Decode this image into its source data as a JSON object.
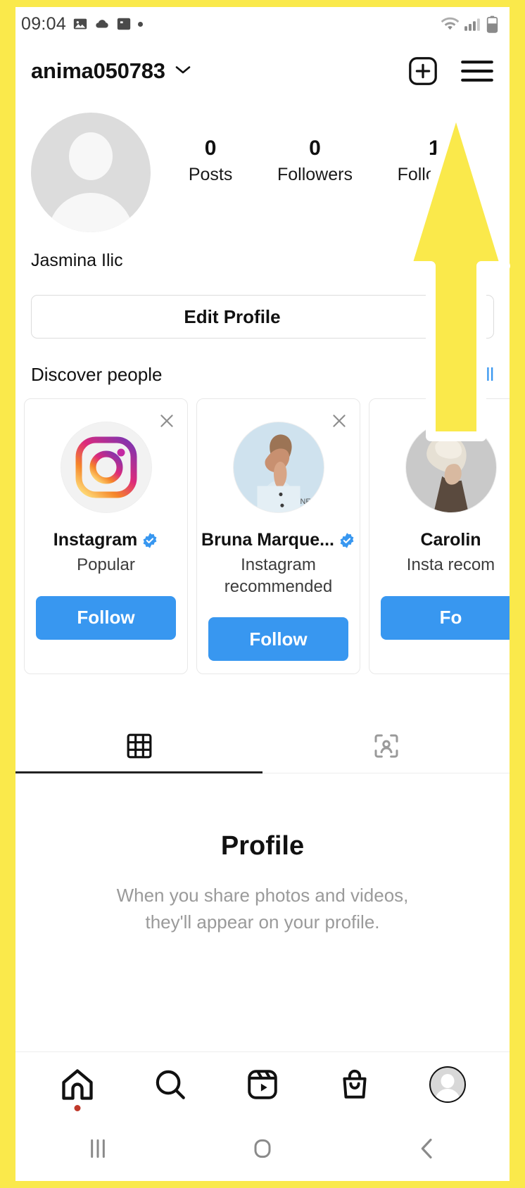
{
  "status_bar": {
    "time": "09:04",
    "icons": [
      "image-icon",
      "cloud-icon",
      "news-icon",
      "dot-icon"
    ],
    "right_icons": [
      "wifi-icon",
      "signal-icon",
      "battery-icon"
    ]
  },
  "header": {
    "username": "anima050783",
    "chevron": "chevron-down-icon",
    "add_button": "plus-square-icon",
    "menu_button": "hamburger-menu-icon"
  },
  "profile": {
    "avatar": "default-avatar-icon",
    "full_name": "Jasmina Ilic",
    "stats": [
      {
        "value": "0",
        "label": "Posts"
      },
      {
        "value": "0",
        "label": "Followers"
      },
      {
        "value": "1",
        "label": "Following"
      }
    ],
    "edit_button": "Edit Profile",
    "expand_button": "chevron-down-icon"
  },
  "discover": {
    "title": "Discover people",
    "see_all": "See All",
    "cards": [
      {
        "name": "Instagram",
        "subtitle": "Popular",
        "verified": true,
        "follow_label": "Follow",
        "avatar": "instagram-logo-icon",
        "close": "close-icon"
      },
      {
        "name": "Bruna Marque...",
        "subtitle": "Instagram recommended",
        "verified": true,
        "follow_label": "Follow",
        "avatar": "person-photo-icon",
        "close": "close-icon"
      },
      {
        "name": "Carolin",
        "subtitle": "Insta recom",
        "verified": false,
        "follow_label": "Fo",
        "avatar": "person-photo-icon",
        "close": "close-icon"
      }
    ]
  },
  "tabs": [
    {
      "name": "grid-tab",
      "icon": "grid-icon",
      "active": true
    },
    {
      "name": "tagged-tab",
      "icon": "tagged-person-icon",
      "active": false
    }
  ],
  "empty_state": {
    "title": "Profile",
    "line1": "When you share photos and videos,",
    "line2": "they'll appear on your profile."
  },
  "bottom_nav": [
    {
      "name": "home",
      "icon": "home-icon",
      "badge": true
    },
    {
      "name": "search",
      "icon": "search-icon",
      "badge": false
    },
    {
      "name": "reels",
      "icon": "reels-icon",
      "badge": false
    },
    {
      "name": "shop",
      "icon": "shop-bag-icon",
      "badge": false
    },
    {
      "name": "profile",
      "icon": "profile-avatar-icon",
      "badge": false
    }
  ],
  "android_nav": [
    {
      "name": "recents",
      "icon": "recents-icon"
    },
    {
      "name": "home",
      "icon": "home-square-icon"
    },
    {
      "name": "back",
      "icon": "back-chevron-icon"
    }
  ],
  "annotation": {
    "type": "arrow-overlay",
    "color": "#FAE94B",
    "points_to": "hamburger-menu-icon"
  }
}
